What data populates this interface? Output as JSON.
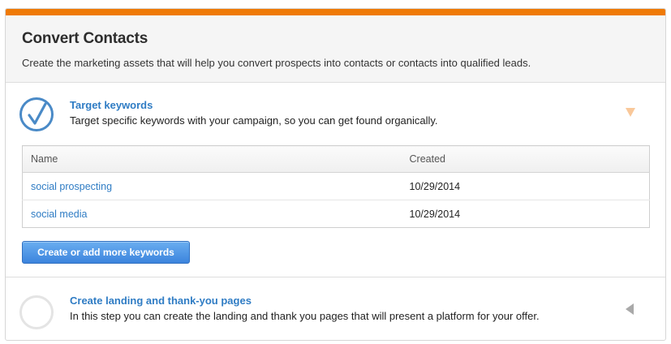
{
  "header": {
    "title": "Convert Contacts",
    "subtitle": "Create the marketing assets that will help you convert prospects into contacts or contacts into qualified leads."
  },
  "steps": [
    {
      "title": "Target keywords",
      "description": "Target specific keywords with your campaign, so you can get found organically.",
      "status": "complete",
      "expanded": true
    },
    {
      "title": "Create landing and thank-you pages",
      "description": "In this step you can create the landing and thank you pages that will present a platform for your offer.",
      "status": "incomplete",
      "expanded": false
    }
  ],
  "keywords_table": {
    "columns": [
      "Name",
      "Created"
    ],
    "rows": [
      {
        "name": "social prospecting",
        "created": "10/29/2014"
      },
      {
        "name": "social media",
        "created": "10/29/2014"
      }
    ]
  },
  "buttons": {
    "add_keywords": "Create or add more keywords"
  },
  "colors": {
    "accent_bar": "#ef7a06",
    "link": "#2f7cc4",
    "button": "#3c84dd",
    "check": "#4a8ac7"
  },
  "icons": {
    "step1_status": "checkmark-circle-icon",
    "step2_status": "empty-circle-icon",
    "step1_toggle": "triangle-down-icon",
    "step2_toggle": "triangle-left-icon"
  }
}
